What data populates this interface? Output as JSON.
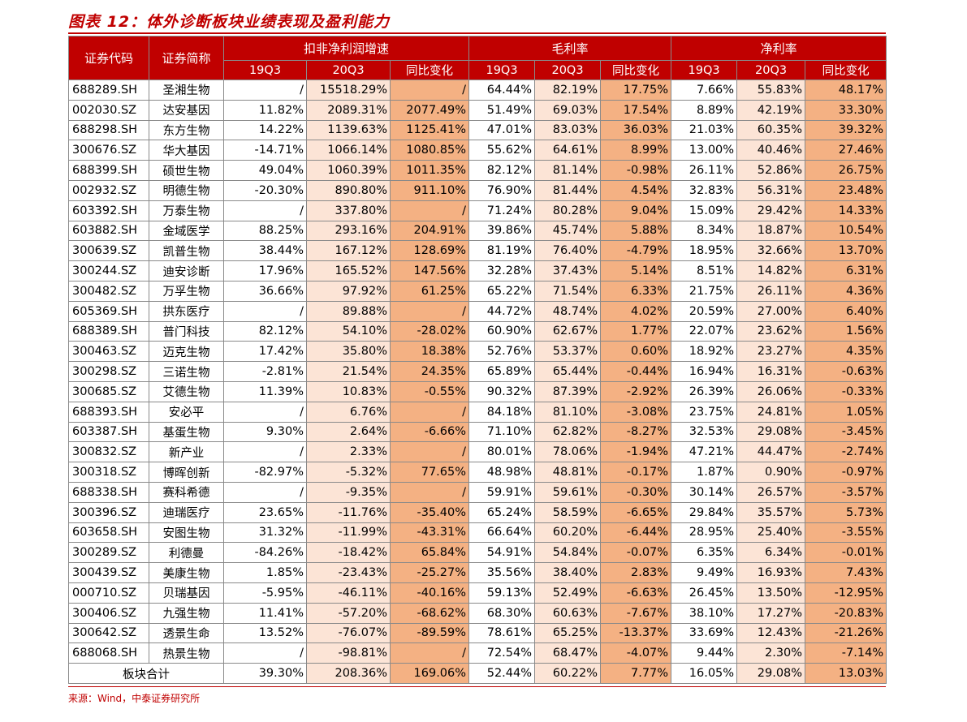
{
  "title": "图表 12：体外诊断板块业绩表现及盈利能力",
  "header": {
    "code": "证券代码",
    "name": "证券简称",
    "groups": [
      "扣非净利润增速",
      "毛利率",
      "净利率"
    ],
    "sub": [
      "19Q3",
      "20Q3",
      "同比变化"
    ]
  },
  "rows": [
    [
      "688289.SH",
      "圣湘生物",
      "/",
      "15518.29%",
      "/",
      "64.44%",
      "82.19%",
      "17.75%",
      "7.66%",
      "55.83%",
      "48.17%"
    ],
    [
      "002030.SZ",
      "达安基因",
      "11.82%",
      "2089.31%",
      "2077.49%",
      "51.49%",
      "69.03%",
      "17.54%",
      "8.89%",
      "42.19%",
      "33.30%"
    ],
    [
      "688298.SH",
      "东方生物",
      "14.22%",
      "1139.63%",
      "1125.41%",
      "47.01%",
      "83.03%",
      "36.03%",
      "21.03%",
      "60.35%",
      "39.32%"
    ],
    [
      "300676.SZ",
      "华大基因",
      "-14.71%",
      "1066.14%",
      "1080.85%",
      "55.62%",
      "64.61%",
      "8.99%",
      "13.00%",
      "40.46%",
      "27.46%"
    ],
    [
      "688399.SH",
      "硕世生物",
      "49.04%",
      "1060.39%",
      "1011.35%",
      "82.12%",
      "81.14%",
      "-0.98%",
      "26.11%",
      "52.86%",
      "26.75%"
    ],
    [
      "002932.SZ",
      "明德生物",
      "-20.30%",
      "890.80%",
      "911.10%",
      "76.90%",
      "81.44%",
      "4.54%",
      "32.83%",
      "56.31%",
      "23.48%"
    ],
    [
      "603392.SH",
      "万泰生物",
      "/",
      "337.80%",
      "/",
      "71.24%",
      "80.28%",
      "9.04%",
      "15.09%",
      "29.42%",
      "14.33%"
    ],
    [
      "603882.SH",
      "金域医学",
      "88.25%",
      "293.16%",
      "204.91%",
      "39.86%",
      "45.74%",
      "5.88%",
      "8.34%",
      "18.87%",
      "10.54%"
    ],
    [
      "300639.SZ",
      "凯普生物",
      "38.44%",
      "167.12%",
      "128.69%",
      "81.19%",
      "76.40%",
      "-4.79%",
      "18.95%",
      "32.66%",
      "13.70%"
    ],
    [
      "300244.SZ",
      "迪安诊断",
      "17.96%",
      "165.52%",
      "147.56%",
      "32.28%",
      "37.43%",
      "5.14%",
      "8.51%",
      "14.82%",
      "6.31%"
    ],
    [
      "300482.SZ",
      "万孚生物",
      "36.66%",
      "97.92%",
      "61.25%",
      "65.22%",
      "71.54%",
      "6.33%",
      "21.75%",
      "26.11%",
      "4.36%"
    ],
    [
      "605369.SH",
      "拱东医疗",
      "/",
      "89.88%",
      "/",
      "44.72%",
      "48.74%",
      "4.02%",
      "20.59%",
      "27.00%",
      "6.40%"
    ],
    [
      "688389.SH",
      "普门科技",
      "82.12%",
      "54.10%",
      "-28.02%",
      "60.90%",
      "62.67%",
      "1.77%",
      "22.07%",
      "23.62%",
      "1.56%"
    ],
    [
      "300463.SZ",
      "迈克生物",
      "17.42%",
      "35.80%",
      "18.38%",
      "52.76%",
      "53.37%",
      "0.60%",
      "18.92%",
      "23.27%",
      "4.35%"
    ],
    [
      "300298.SZ",
      "三诺生物",
      "-2.81%",
      "21.54%",
      "24.35%",
      "65.89%",
      "65.44%",
      "-0.44%",
      "16.94%",
      "16.31%",
      "-0.63%"
    ],
    [
      "300685.SZ",
      "艾德生物",
      "11.39%",
      "10.83%",
      "-0.55%",
      "90.32%",
      "87.39%",
      "-2.92%",
      "26.39%",
      "26.06%",
      "-0.33%"
    ],
    [
      "688393.SH",
      "安必平",
      "/",
      "6.76%",
      "/",
      "84.18%",
      "81.10%",
      "-3.08%",
      "23.75%",
      "24.81%",
      "1.05%"
    ],
    [
      "603387.SH",
      "基蛋生物",
      "9.30%",
      "2.64%",
      "-6.66%",
      "71.10%",
      "62.82%",
      "-8.27%",
      "32.53%",
      "29.08%",
      "-3.45%"
    ],
    [
      "300832.SZ",
      "新产业",
      "/",
      "2.33%",
      "/",
      "80.01%",
      "78.06%",
      "-1.94%",
      "47.21%",
      "44.47%",
      "-2.74%"
    ],
    [
      "300318.SZ",
      "博晖创新",
      "-82.97%",
      "-5.32%",
      "77.65%",
      "48.98%",
      "48.81%",
      "-0.17%",
      "1.87%",
      "0.90%",
      "-0.97%"
    ],
    [
      "688338.SH",
      "赛科希德",
      "/",
      "-9.35%",
      "/",
      "59.91%",
      "59.61%",
      "-0.30%",
      "30.14%",
      "26.57%",
      "-3.57%"
    ],
    [
      "300396.SZ",
      "迪瑞医疗",
      "23.65%",
      "-11.76%",
      "-35.40%",
      "65.24%",
      "58.59%",
      "-6.65%",
      "29.84%",
      "35.57%",
      "5.73%"
    ],
    [
      "603658.SH",
      "安图生物",
      "31.32%",
      "-11.99%",
      "-43.31%",
      "66.64%",
      "60.20%",
      "-6.44%",
      "28.95%",
      "25.40%",
      "-3.55%"
    ],
    [
      "300289.SZ",
      "利德曼",
      "-84.26%",
      "-18.42%",
      "65.84%",
      "54.91%",
      "54.84%",
      "-0.07%",
      "6.35%",
      "6.34%",
      "-0.01%"
    ],
    [
      "300439.SZ",
      "美康生物",
      "1.85%",
      "-23.43%",
      "-25.27%",
      "35.56%",
      "38.40%",
      "2.83%",
      "9.49%",
      "16.93%",
      "7.43%"
    ],
    [
      "000710.SZ",
      "贝瑞基因",
      "-5.95%",
      "-46.11%",
      "-40.16%",
      "59.13%",
      "52.49%",
      "-6.63%",
      "26.45%",
      "13.50%",
      "-12.95%"
    ],
    [
      "300406.SZ",
      "九强生物",
      "11.41%",
      "-57.20%",
      "-68.62%",
      "68.30%",
      "60.63%",
      "-7.67%",
      "38.10%",
      "17.27%",
      "-20.83%"
    ],
    [
      "300642.SZ",
      "透景生命",
      "13.52%",
      "-76.07%",
      "-89.59%",
      "78.61%",
      "65.25%",
      "-13.37%",
      "33.69%",
      "12.43%",
      "-21.26%"
    ],
    [
      "688068.SH",
      "热景生物",
      "/",
      "-98.81%",
      "/",
      "72.54%",
      "68.47%",
      "-4.07%",
      "9.44%",
      "2.30%",
      "-7.14%"
    ]
  ],
  "total": {
    "label": "板块合计",
    "values": [
      "39.30%",
      "208.36%",
      "169.06%",
      "52.44%",
      "60.22%",
      "7.77%",
      "16.05%",
      "29.08%",
      "13.03%"
    ]
  },
  "source": "来源：Wind，中泰证券研究所"
}
